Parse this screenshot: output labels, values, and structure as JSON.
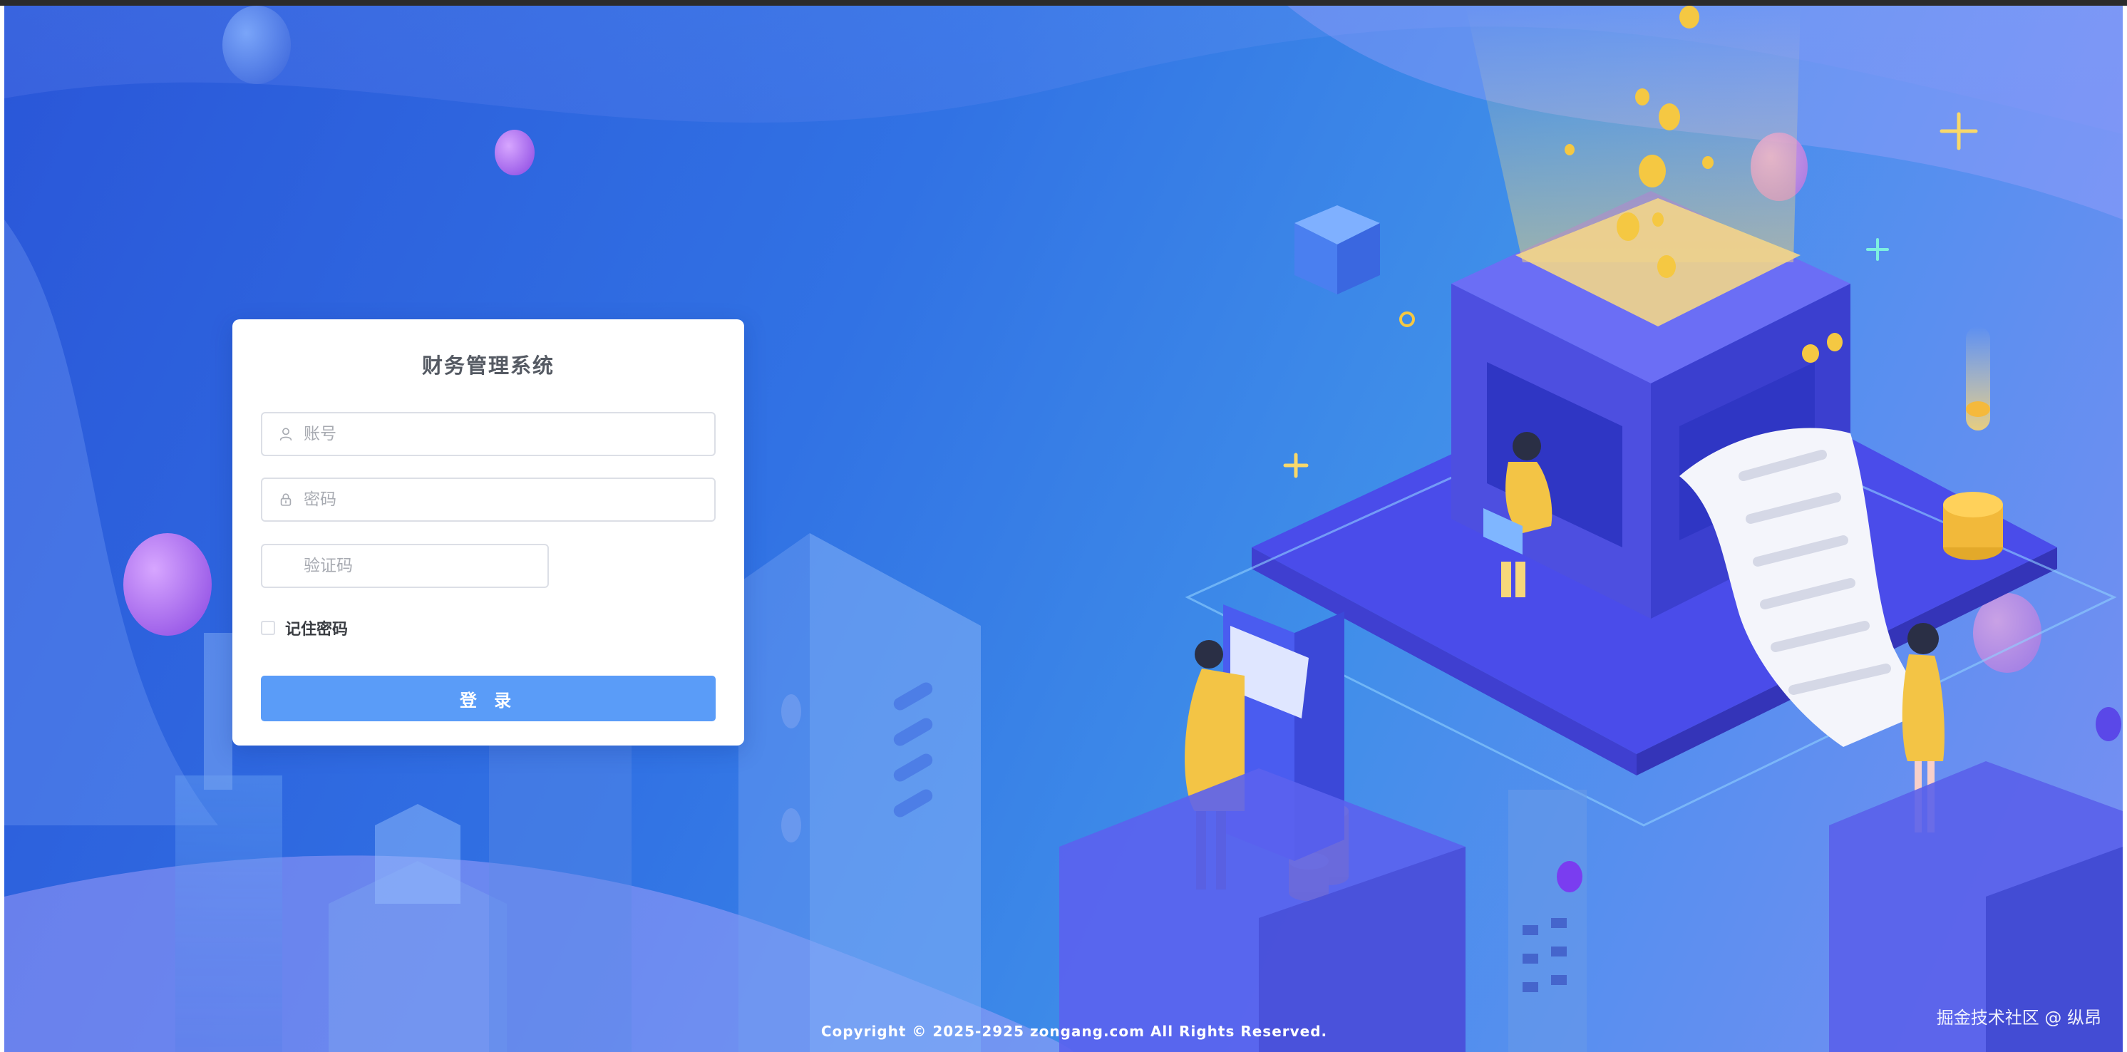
{
  "login": {
    "title": "财务管理系统",
    "username_placeholder": "账号",
    "password_placeholder": "密码",
    "captcha_placeholder": "验证码",
    "remember_label": "记住密码",
    "remember_checked": false,
    "submit_label": "登 录"
  },
  "footer": {
    "copyright": "Copyright © 2025-2925 zongang.com All Rights Reserved."
  },
  "watermark": {
    "text": "掘金技术社区 @ 纵昂"
  },
  "icons": {
    "username": "user-icon",
    "password": "lock-icon"
  },
  "colors": {
    "button": "#5a9cf8",
    "background_primary": "#3172e4",
    "card": "#ffffff",
    "illustration_gold": "#f5c842"
  }
}
